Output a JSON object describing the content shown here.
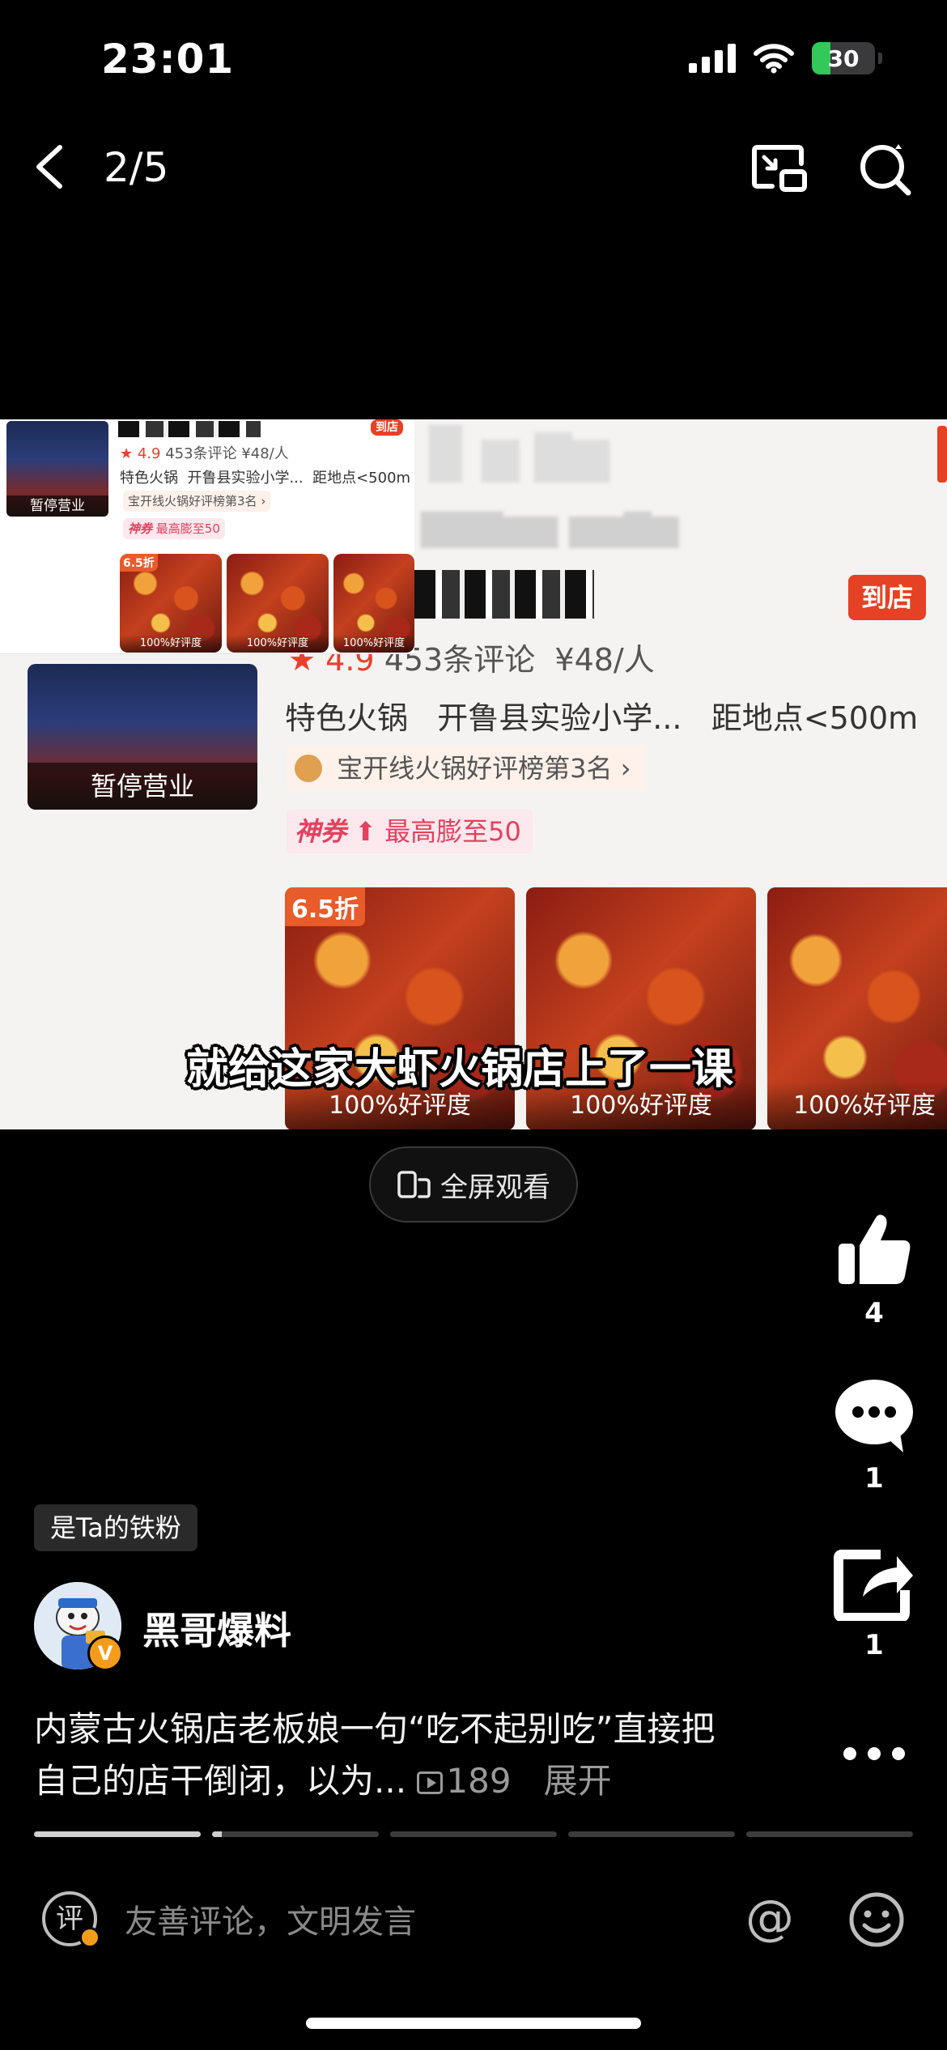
{
  "status_bar": {
    "time": "23:01",
    "battery": "30"
  },
  "nav": {
    "page_indicator": "2/5"
  },
  "content_image": {
    "main_card": {
      "rating": "4.9",
      "reviews": "453条评论",
      "price": "¥48/人",
      "category": "特色火锅",
      "location": "开鲁县实验小学...",
      "distance": "距地点<500m",
      "ranking": "宝开线火锅好评榜第3名 ›",
      "coupon_brand": "神券",
      "coupon_text": "最高膨至50",
      "visit_button": "到店",
      "store_status": "暂停营业",
      "discount": "6.5折",
      "good_rating": "100%好评度"
    },
    "thumb_card": {
      "rating": "★ 4.9",
      "reviews": "453条评论",
      "price": "¥48/人",
      "category": "特色火锅",
      "location": "开鲁县实验小学...",
      "distance": "距地点<500m",
      "ranking": "宝开线火锅好评榜第3名 ›",
      "coupon_brand": "神券",
      "coupon_text": "最高膨至50",
      "visit_button": "到店",
      "store_status": "暂停营业",
      "discount": "6.5折",
      "good_rating": "100%好评度"
    },
    "subtitle": "就给这家大虾火锅店上了一课"
  },
  "fullscreen_button": "全屏观看",
  "actions": {
    "likes": "4",
    "comments": "1",
    "shares": "1"
  },
  "fan_badge": "是Ta的铁粉",
  "author": {
    "name": "黑哥爆料",
    "verified_badge": "V"
  },
  "description": {
    "text": "内蒙古火锅店老板娘一句“吃不起别吃”直接把自己的店干倒闭，以为...",
    "views": "189",
    "expand": "展开"
  },
  "progress": {
    "total": 5,
    "current": 2,
    "segment_fill": [
      1,
      0.06,
      0,
      0,
      0
    ]
  },
  "comment_bar": {
    "placeholder": "友善评论，文明发言",
    "icon_label": "评",
    "at_label": "@"
  },
  "colors": {
    "background": "#000000",
    "accent": "#e54124",
    "battery": "#34c759",
    "badge": "#f39c1a"
  }
}
